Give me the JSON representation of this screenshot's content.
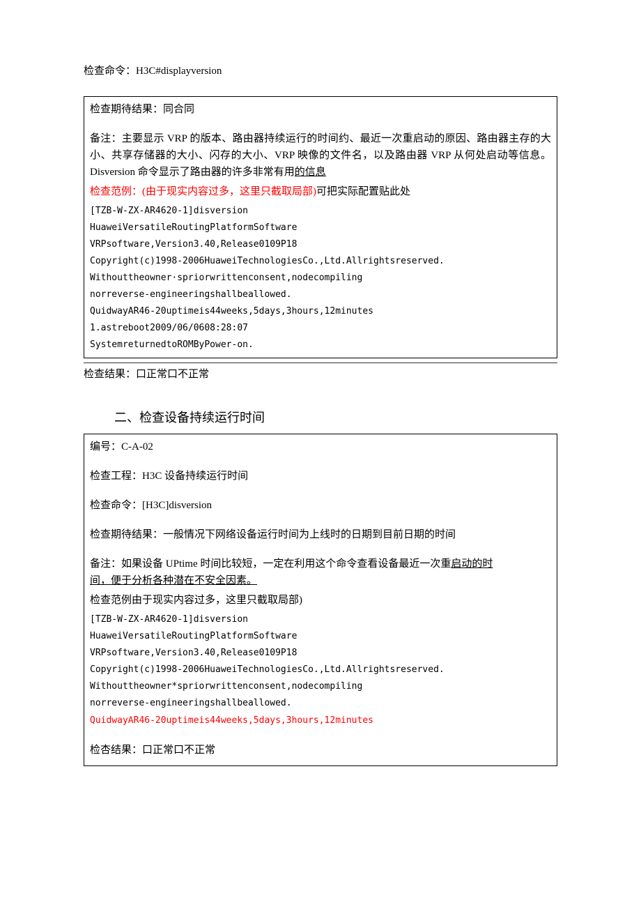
{
  "section1": {
    "check_command_label": "检查命令：",
    "check_command_value": "H3C#displayversion",
    "expected_label": "检查期待结果：",
    "expected_value": "同合同",
    "note_label": "备注：",
    "note_text_part1": "主要显示 VRP 的版本、路由器持续运行的时间约、最近一次重启动的原因、路由器主存的大小、共享存储器的大小、闪存的大小、VRP 映像的文件名，以及路由器 VRP 从何处启动等信息。Disversion 命令显示了路由器的许多非常有用",
    "note_text_underlined": "的信息",
    "example_label_red": "检查范例：(由于现实内容过多，这里只截取局部)",
    "example_suffix": "可把实际配置贴此处",
    "terminal": [
      "[TZB-W-ZX-AR4620-1]disversion",
      "HuaweiVersatileRoutingPlatformSoftware",
      "VRPsoftware,Version3.40,Release0109P18",
      "Copyright(c)1998-2006HuaweiTechnologiesCo.,Ltd.Allrightsreserved.",
      "Withouttheowner·spriorwrittenconsent,nodecompiling",
      "norreverse-engineeringshallbeallowed.",
      "QuidwayAR46-20uptimeis44weeks,5days,3hours,12minutes",
      "1.astreboot2009/06/0608:28:07",
      "SystemreturnedtoROMByPower-on."
    ],
    "result_label": "检查结果：",
    "result_options": "口正常口不正常"
  },
  "section2": {
    "heading": "二、检查设备持续运行时间",
    "id_label": "编号：",
    "id_value": "C-A-02",
    "project_label": "检查工程：",
    "project_value": "H3C 设备持续运行时间",
    "command_label": "检查命令：",
    "command_value": "[H3C]disversion",
    "expected_label": "检查期待结果：",
    "expected_value": "一般情况下网络设备运行时间为上线时的日期到目前日期的时间",
    "note_label": "备注：",
    "note_text_part1": "如果设备 UPtime 时间比较短，一定在利用这个命令查看设备最近一次重",
    "note_underlined1": "启动的时",
    "note_underlined2": "间，便于分析各种潜在不安全因素。",
    "example_label": "检查范例由于现实内容过多，这里只截取局部)",
    "terminal": [
      "[TZB-W-ZX-ΑR4620-1]disversion",
      "HuaweiVersatileRoutingPlatformSoftware",
      "VRPsoftware,Version3.40,Release0109P18",
      "Copyright(c)1998-2006HuaweiTechnologiesCo.,Ltd.Allrightsreserved.",
      "Withouttheowner*spriorwrittenconsent,nodecompiling",
      "norreverse-engineeringshallbeallowed."
    ],
    "terminal_red": "QuidwayΑR46-20uptimeis44weeks,5days,3hours,12minutes",
    "result_label": "检杏结果：",
    "result_options": "口正常口不正常"
  }
}
